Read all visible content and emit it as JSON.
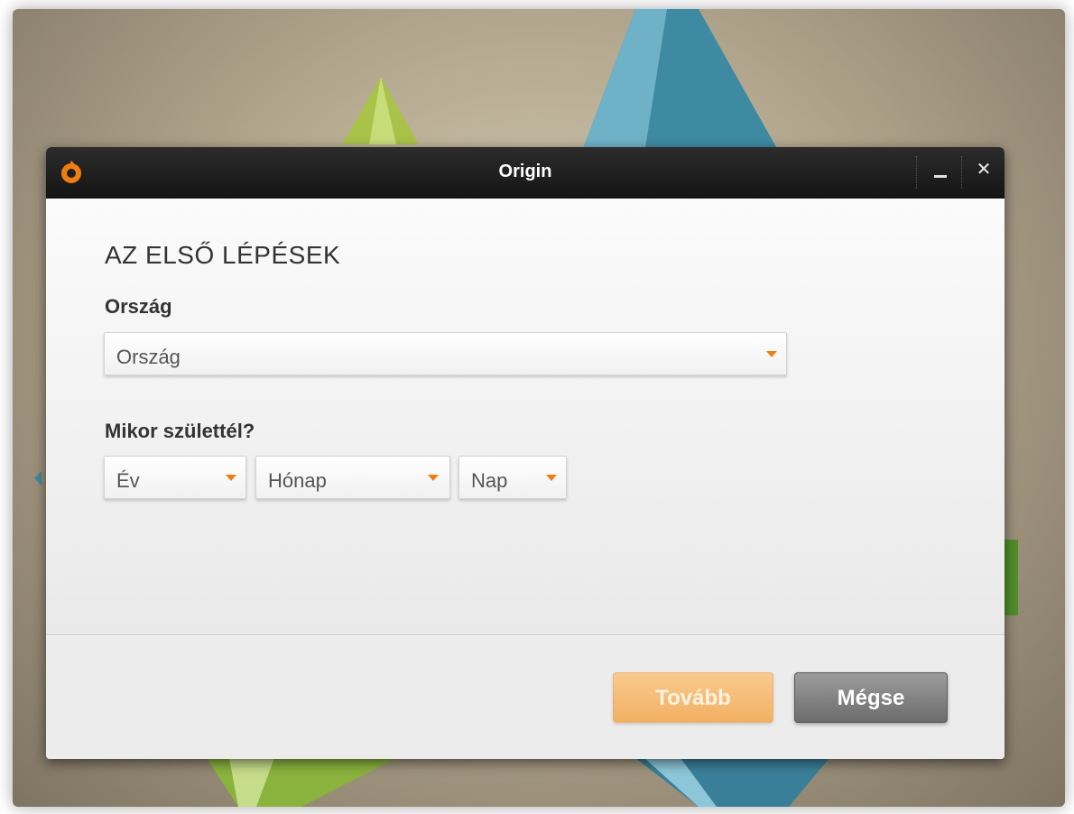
{
  "window": {
    "title": "Origin"
  },
  "form": {
    "heading": "AZ ELSŐ LÉPÉSEK",
    "country_label": "Ország",
    "country_select": "Ország",
    "birth_label": "Mikor születtél?",
    "year_select": "Év",
    "month_select": "Hónap",
    "day_select": "Nap"
  },
  "buttons": {
    "next": "Tovább",
    "cancel": "Mégse"
  },
  "colors": {
    "accent": "#f07d10",
    "titlebar": "#1e1e1e",
    "next_button": "#f6bd78",
    "cancel_button": "#808080"
  }
}
